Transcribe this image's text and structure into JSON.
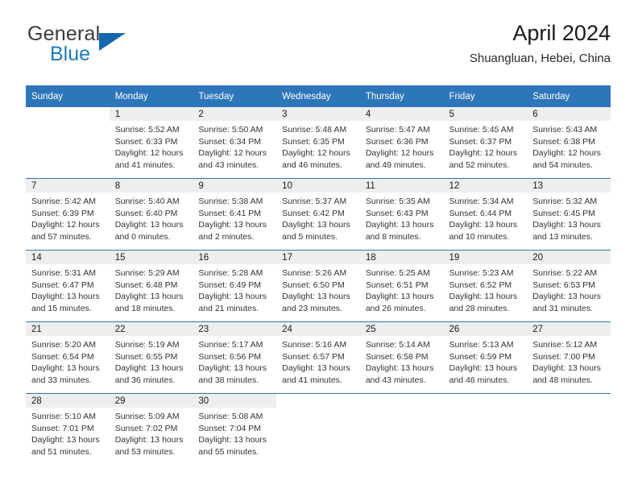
{
  "brand": {
    "word_one": "General",
    "word_two": "Blue",
    "flag_icon": "triangle-flag-icon",
    "color_blue": "#1568b0",
    "color_text": "#3b3b3b"
  },
  "header": {
    "title": "April 2024",
    "location": "Shuangluan, Hebei, China"
  },
  "theme": {
    "header_bar": "#2e76ba",
    "date_band": "#eeeeee",
    "body_text": "#333333"
  },
  "calendar": {
    "weekday_headers": [
      "Sunday",
      "Monday",
      "Tuesday",
      "Wednesday",
      "Thursday",
      "Friday",
      "Saturday"
    ],
    "weeks": [
      [
        {
          "day": "",
          "lines": []
        },
        {
          "day": "1",
          "lines": [
            "Sunrise: 5:52 AM",
            "Sunset: 6:33 PM",
            "Daylight: 12 hours",
            "and 41 minutes."
          ]
        },
        {
          "day": "2",
          "lines": [
            "Sunrise: 5:50 AM",
            "Sunset: 6:34 PM",
            "Daylight: 12 hours",
            "and 43 minutes."
          ]
        },
        {
          "day": "3",
          "lines": [
            "Sunrise: 5:48 AM",
            "Sunset: 6:35 PM",
            "Daylight: 12 hours",
            "and 46 minutes."
          ]
        },
        {
          "day": "4",
          "lines": [
            "Sunrise: 5:47 AM",
            "Sunset: 6:36 PM",
            "Daylight: 12 hours",
            "and 49 minutes."
          ]
        },
        {
          "day": "5",
          "lines": [
            "Sunrise: 5:45 AM",
            "Sunset: 6:37 PM",
            "Daylight: 12 hours",
            "and 52 minutes."
          ]
        },
        {
          "day": "6",
          "lines": [
            "Sunrise: 5:43 AM",
            "Sunset: 6:38 PM",
            "Daylight: 12 hours",
            "and 54 minutes."
          ]
        }
      ],
      [
        {
          "day": "7",
          "lines": [
            "Sunrise: 5:42 AM",
            "Sunset: 6:39 PM",
            "Daylight: 12 hours",
            "and 57 minutes."
          ]
        },
        {
          "day": "8",
          "lines": [
            "Sunrise: 5:40 AM",
            "Sunset: 6:40 PM",
            "Daylight: 13 hours",
            "and 0 minutes."
          ]
        },
        {
          "day": "9",
          "lines": [
            "Sunrise: 5:38 AM",
            "Sunset: 6:41 PM",
            "Daylight: 13 hours",
            "and 2 minutes."
          ]
        },
        {
          "day": "10",
          "lines": [
            "Sunrise: 5:37 AM",
            "Sunset: 6:42 PM",
            "Daylight: 13 hours",
            "and 5 minutes."
          ]
        },
        {
          "day": "11",
          "lines": [
            "Sunrise: 5:35 AM",
            "Sunset: 6:43 PM",
            "Daylight: 13 hours",
            "and 8 minutes."
          ]
        },
        {
          "day": "12",
          "lines": [
            "Sunrise: 5:34 AM",
            "Sunset: 6:44 PM",
            "Daylight: 13 hours",
            "and 10 minutes."
          ]
        },
        {
          "day": "13",
          "lines": [
            "Sunrise: 5:32 AM",
            "Sunset: 6:45 PM",
            "Daylight: 13 hours",
            "and 13 minutes."
          ]
        }
      ],
      [
        {
          "day": "14",
          "lines": [
            "Sunrise: 5:31 AM",
            "Sunset: 6:47 PM",
            "Daylight: 13 hours",
            "and 15 minutes."
          ]
        },
        {
          "day": "15",
          "lines": [
            "Sunrise: 5:29 AM",
            "Sunset: 6:48 PM",
            "Daylight: 13 hours",
            "and 18 minutes."
          ]
        },
        {
          "day": "16",
          "lines": [
            "Sunrise: 5:28 AM",
            "Sunset: 6:49 PM",
            "Daylight: 13 hours",
            "and 21 minutes."
          ]
        },
        {
          "day": "17",
          "lines": [
            "Sunrise: 5:26 AM",
            "Sunset: 6:50 PM",
            "Daylight: 13 hours",
            "and 23 minutes."
          ]
        },
        {
          "day": "18",
          "lines": [
            "Sunrise: 5:25 AM",
            "Sunset: 6:51 PM",
            "Daylight: 13 hours",
            "and 26 minutes."
          ]
        },
        {
          "day": "19",
          "lines": [
            "Sunrise: 5:23 AM",
            "Sunset: 6:52 PM",
            "Daylight: 13 hours",
            "and 28 minutes."
          ]
        },
        {
          "day": "20",
          "lines": [
            "Sunrise: 5:22 AM",
            "Sunset: 6:53 PM",
            "Daylight: 13 hours",
            "and 31 minutes."
          ]
        }
      ],
      [
        {
          "day": "21",
          "lines": [
            "Sunrise: 5:20 AM",
            "Sunset: 6:54 PM",
            "Daylight: 13 hours",
            "and 33 minutes."
          ]
        },
        {
          "day": "22",
          "lines": [
            "Sunrise: 5:19 AM",
            "Sunset: 6:55 PM",
            "Daylight: 13 hours",
            "and 36 minutes."
          ]
        },
        {
          "day": "23",
          "lines": [
            "Sunrise: 5:17 AM",
            "Sunset: 6:56 PM",
            "Daylight: 13 hours",
            "and 38 minutes."
          ]
        },
        {
          "day": "24",
          "lines": [
            "Sunrise: 5:16 AM",
            "Sunset: 6:57 PM",
            "Daylight: 13 hours",
            "and 41 minutes."
          ]
        },
        {
          "day": "25",
          "lines": [
            "Sunrise: 5:14 AM",
            "Sunset: 6:58 PM",
            "Daylight: 13 hours",
            "and 43 minutes."
          ]
        },
        {
          "day": "26",
          "lines": [
            "Sunrise: 5:13 AM",
            "Sunset: 6:59 PM",
            "Daylight: 13 hours",
            "and 46 minutes."
          ]
        },
        {
          "day": "27",
          "lines": [
            "Sunrise: 5:12 AM",
            "Sunset: 7:00 PM",
            "Daylight: 13 hours",
            "and 48 minutes."
          ]
        }
      ],
      [
        {
          "day": "28",
          "lines": [
            "Sunrise: 5:10 AM",
            "Sunset: 7:01 PM",
            "Daylight: 13 hours",
            "and 51 minutes."
          ]
        },
        {
          "day": "29",
          "lines": [
            "Sunrise: 5:09 AM",
            "Sunset: 7:02 PM",
            "Daylight: 13 hours",
            "and 53 minutes."
          ]
        },
        {
          "day": "30",
          "lines": [
            "Sunrise: 5:08 AM",
            "Sunset: 7:04 PM",
            "Daylight: 13 hours",
            "and 55 minutes."
          ]
        },
        {
          "day": "",
          "lines": []
        },
        {
          "day": "",
          "lines": []
        },
        {
          "day": "",
          "lines": []
        },
        {
          "day": "",
          "lines": []
        }
      ]
    ]
  }
}
